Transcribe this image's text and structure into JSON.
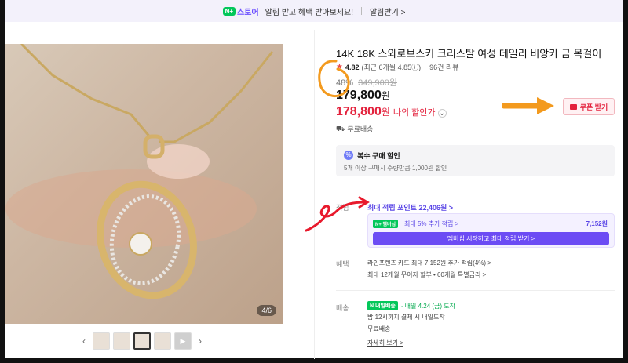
{
  "topbar": {
    "badge": "N+",
    "store": "스토어",
    "message": "알림 받고 혜택 받아보세요!",
    "notify_label": "알림받기 >"
  },
  "gallery": {
    "page_indicator": "4/6",
    "thumb_count": 5,
    "active_thumb": 3
  },
  "product": {
    "title": "14K 18K 스와로브스키 크리스탈 여성 데일리 비앙카 금 목걸이",
    "rating": "4.82",
    "rating_sub": "(최근 6개월 4.85ⓘ)",
    "reviews": "96건 리뷰",
    "discount_pct": "48%",
    "original_price": "349,900원",
    "price": "179,800",
    "price_unit": "원",
    "my_price": "178,800",
    "my_price_unit": "원",
    "my_price_label": "나의 할인가",
    "free_shipping": "무료배송",
    "coupon_label": "쿠폰 받기"
  },
  "multibuy": {
    "title": "복수 구매 할인",
    "desc": "5개 이상 구매시 수량만큼 1,000원 할인"
  },
  "points": {
    "label": "적립",
    "max_points": "최대 적립 포인트 22,406원 >",
    "member_badge": "N+ 멤버십",
    "member_text": "최대 5% 추가 적립 >",
    "member_amount": "7,152원",
    "member_button": "멤버십 시작하고 최대 적립 받기 >"
  },
  "benefits": {
    "label": "혜택",
    "line1": "라인프렌즈 카드 최대 7,152원 추가 적립(4%) >",
    "line2": "최대 12개월 무이자 할부 • 60개월 특별금리 >"
  },
  "shipping": {
    "label": "배송",
    "badge": "N 내일배송",
    "arrival": "· 내일 4.24 (금) 도착",
    "line2": "밤 12시까지 결제 시 내일도착",
    "line3": "무료배송",
    "more": "자세히 보기 >"
  },
  "colors": {
    "accent_red": "#e3213c",
    "accent_purple": "#5a46e6",
    "naver_green": "#03c75a",
    "annotation_orange": "#f39a1e",
    "annotation_red": "#e8192c"
  }
}
